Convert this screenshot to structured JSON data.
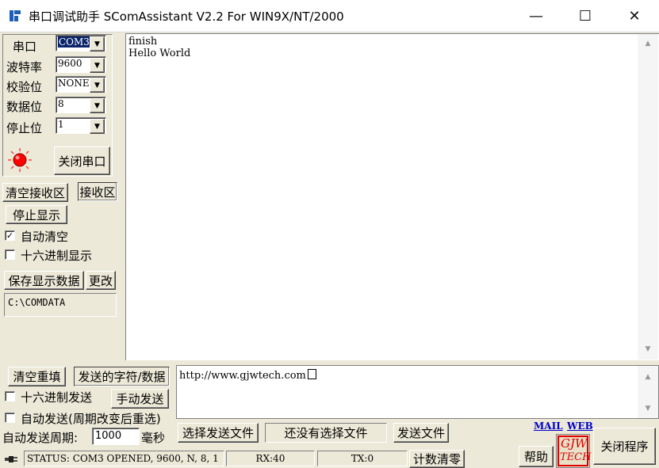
{
  "window": {
    "title": "串口调试助手 SComAssistant V2.2 For WIN9X/NT/2000",
    "minimize_glyph": "—",
    "maximize_glyph": "☐",
    "close_glyph": "✕"
  },
  "serial": {
    "port_label": "串口",
    "port_value": "COM3",
    "baud_label": "波特率",
    "baud_value": "9600",
    "parity_label": "校验位",
    "parity_value": "NONE",
    "databits_label": "数据位",
    "databits_value": "8",
    "stopbits_label": "停止位",
    "stopbits_value": "1",
    "toggle_button": "关闭串口",
    "indicator_color": "#ff0000"
  },
  "receive": {
    "clear_button": "清空接收区",
    "area_label": "接收区",
    "stop_display_button": "停止显示",
    "auto_clear_label": "自动清空",
    "auto_clear_checked": true,
    "hex_display_label": "十六进制显示",
    "hex_display_checked": false,
    "save_button": "保存显示数据",
    "change_button": "更改",
    "path": "C:\\COMDATA",
    "text_line1": "finish",
    "text_line2": "Hello World"
  },
  "send": {
    "clear_resend_button": "清空重填",
    "area_label": "发送的字符/数据",
    "hex_send_label": "十六进制发送",
    "hex_send_checked": false,
    "manual_send_button": "手动发送",
    "auto_send_label": "自动发送(周期改变后重选)",
    "auto_send_checked": false,
    "period_label": "自动发送周期:",
    "period_value": "1000",
    "period_unit": "毫秒",
    "text": "http://www.gjwtech.com",
    "select_file_button": "选择发送文件",
    "file_status": "还没有选择文件",
    "send_file_button": "发送文件"
  },
  "links": {
    "mail": "MAIL",
    "web": "WEB"
  },
  "status": {
    "status_text": "STATUS: COM3 OPENED, 9600, N, 8, 1",
    "rx": "RX:40",
    "tx": "TX:0",
    "reset_count_button": "计数清零",
    "help_button": "帮助",
    "logo_line1": "GJW",
    "logo_line2": "TECH",
    "close_program_button": "关闭程序"
  }
}
